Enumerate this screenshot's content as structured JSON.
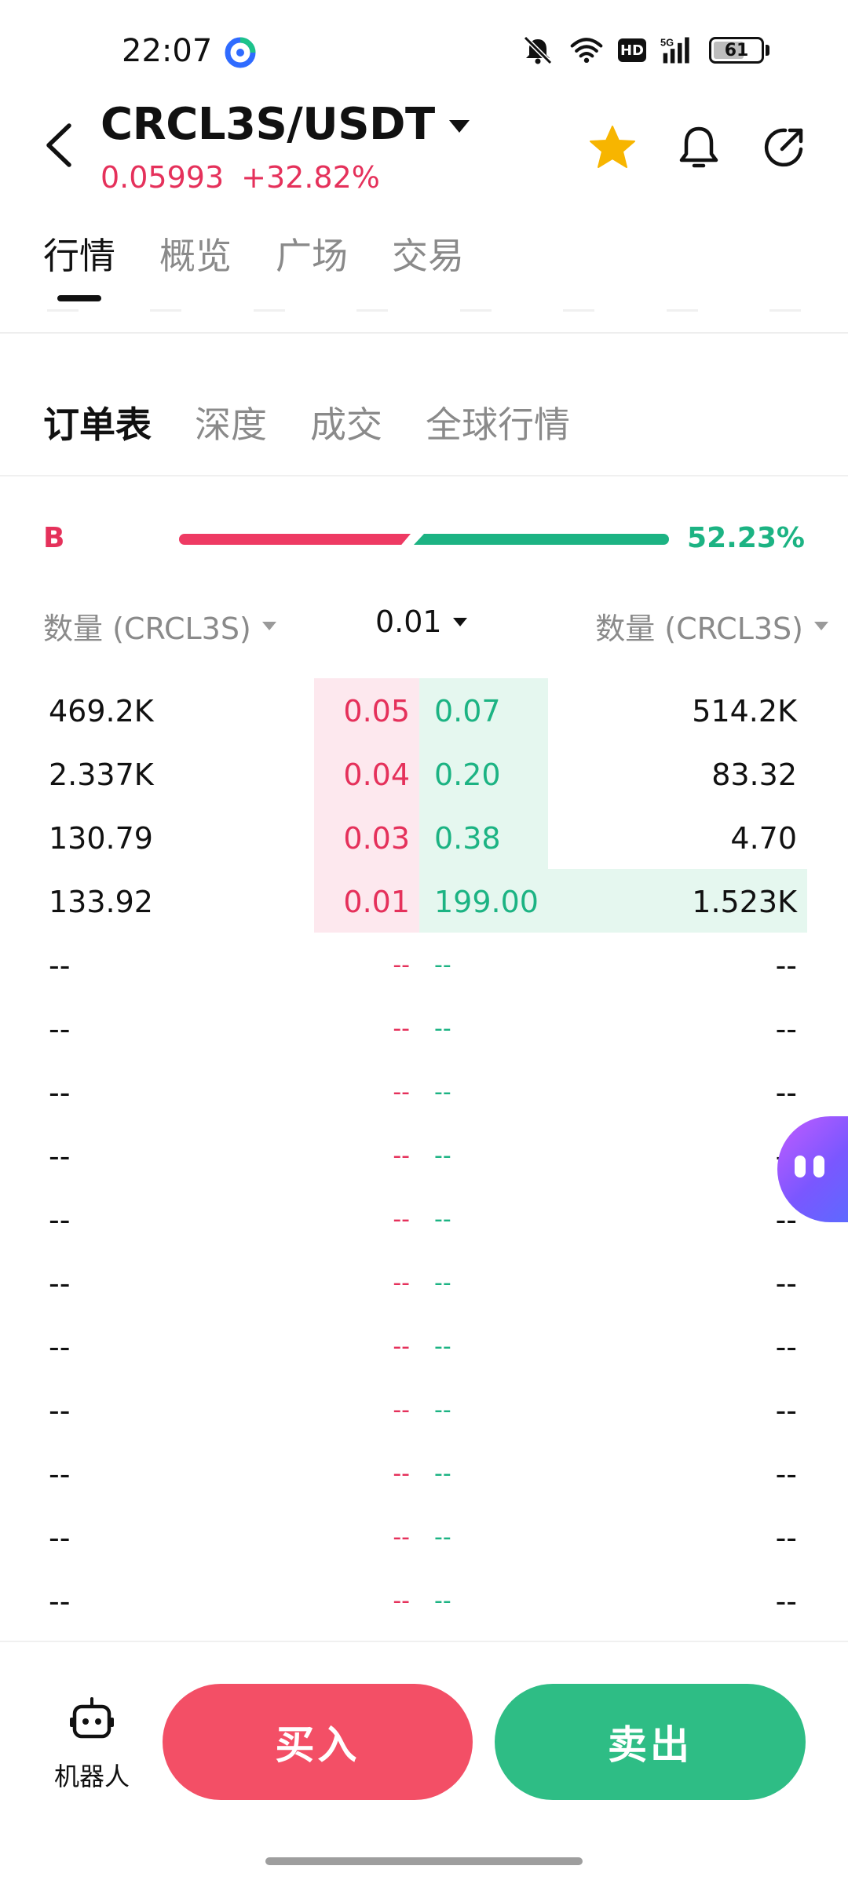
{
  "status_bar": {
    "time": "22:07",
    "network": "5G",
    "hd": "HD",
    "battery": "61",
    "icons": [
      "app-logo-icon",
      "mute-icon",
      "wifi-icon",
      "hd-icon",
      "signal-icon",
      "battery-icon"
    ]
  },
  "header": {
    "pair": "CRCL3S/USDT",
    "price": "0.05993",
    "change": "+32.82%",
    "icons": [
      "back-icon",
      "caret-down-icon",
      "star-icon",
      "bell-icon",
      "share-icon"
    ],
    "colors": {
      "price": "#e5315b",
      "star": "#f7b500"
    }
  },
  "main_tabs": [
    {
      "label": "行情",
      "active": true
    },
    {
      "label": "概览",
      "active": false
    },
    {
      "label": "广场",
      "active": false
    },
    {
      "label": "交易",
      "active": false
    }
  ],
  "sub_tabs": [
    {
      "label": "订单表",
      "active": true
    },
    {
      "label": "深度",
      "active": false
    },
    {
      "label": "成交",
      "active": false
    },
    {
      "label": "全球行情",
      "active": false
    }
  ],
  "ratio": {
    "label": "B",
    "percent": "52.23%",
    "colors": {
      "buy": "#ee3a63",
      "sell": "#1cb383"
    }
  },
  "columns": {
    "bid_qty": "数量 (CRCL3S)",
    "precision": "0.01",
    "ask_qty": "数量 (CRCL3S)"
  },
  "order_book": [
    {
      "bid_qty": "469.2K",
      "bid_price": "0.05",
      "ask_price": "0.07",
      "ask_qty": "514.2K"
    },
    {
      "bid_qty": "2.337K",
      "bid_price": "0.04",
      "ask_price": "0.20",
      "ask_qty": "83.32"
    },
    {
      "bid_qty": "130.79",
      "bid_price": "0.03",
      "ask_price": "0.38",
      "ask_qty": "4.70"
    },
    {
      "bid_qty": "133.92",
      "bid_price": "0.01",
      "ask_price": "199.00",
      "ask_qty": "1.523K"
    },
    {
      "bid_qty": "--",
      "bid_price": "--",
      "ask_price": "--",
      "ask_qty": "--"
    },
    {
      "bid_qty": "--",
      "bid_price": "--",
      "ask_price": "--",
      "ask_qty": "--"
    },
    {
      "bid_qty": "--",
      "bid_price": "--",
      "ask_price": "--",
      "ask_qty": "--"
    },
    {
      "bid_qty": "--",
      "bid_price": "--",
      "ask_price": "--",
      "ask_qty": "--"
    },
    {
      "bid_qty": "--",
      "bid_price": "--",
      "ask_price": "--",
      "ask_qty": "--"
    },
    {
      "bid_qty": "--",
      "bid_price": "--",
      "ask_price": "--",
      "ask_qty": "--"
    },
    {
      "bid_qty": "--",
      "bid_price": "--",
      "ask_price": "--",
      "ask_qty": "--"
    },
    {
      "bid_qty": "--",
      "bid_price": "--",
      "ask_price": "--",
      "ask_qty": "--"
    },
    {
      "bid_qty": "--",
      "bid_price": "--",
      "ask_price": "--",
      "ask_qty": "--"
    },
    {
      "bid_qty": "--",
      "bid_price": "--",
      "ask_price": "--",
      "ask_qty": "--"
    },
    {
      "bid_qty": "--",
      "bid_price": "--",
      "ask_price": "--",
      "ask_qty": "--"
    }
  ],
  "bottom": {
    "robot_label": "机器人",
    "buy_label": "买入",
    "sell_label": "卖出",
    "colors": {
      "buy": "#f34f66",
      "sell": "#2ebd85"
    }
  }
}
